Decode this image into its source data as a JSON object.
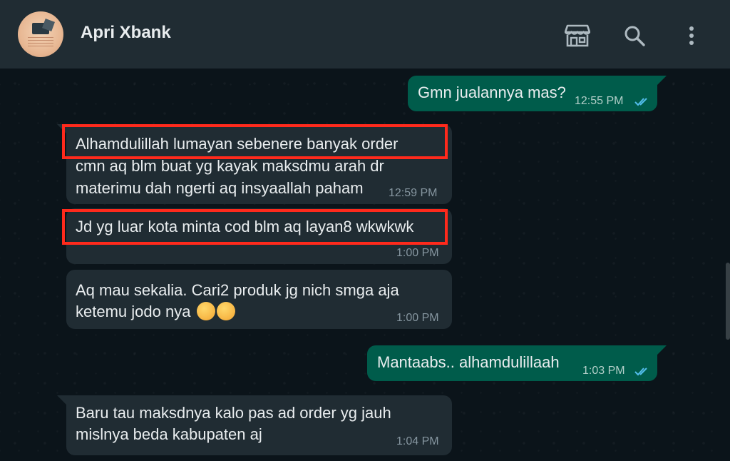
{
  "header": {
    "contact_name": "Apri Xbank",
    "icons": [
      "shop-icon",
      "search-icon",
      "more-vertical-icon"
    ]
  },
  "colors": {
    "header_bg": "#202c33",
    "chat_bg": "#0b141a",
    "incoming_bubble": "#202c33",
    "outgoing_bubble": "#005c4b",
    "highlight": "#ff2a1c",
    "read_ticks": "#53bdeb"
  },
  "messages": [
    {
      "direction": "out",
      "lines": [
        "Gmn jualannya mas?"
      ],
      "time": "12:55 PM",
      "status": "read"
    },
    {
      "direction": "in",
      "lines": [
        "Alhamdulillah lumayan sebenere banyak order",
        "cmn aq blm buat yg kayak maksdmu arah dr",
        "materimu dah ngerti aq insyaallah paham"
      ],
      "time": "12:59 PM",
      "highlight_first_line": true
    },
    {
      "direction": "in",
      "lines": [
        "Jd yg luar kota minta cod blm aq layan8 wkwkwk"
      ],
      "time": "1:00 PM",
      "highlight_first_line": true
    },
    {
      "direction": "in",
      "lines": [
        "Aq mau sekalia. Cari2 produk jg nich smga aja",
        "ketemu jodo nya"
      ],
      "time": "1:00 PM",
      "emoji": "face-with-hand-over-mouth x2"
    },
    {
      "direction": "out",
      "lines": [
        "Mantaabs.. alhamdulillaah"
      ],
      "time": "1:03 PM",
      "status": "read"
    },
    {
      "direction": "in",
      "lines": [
        "Baru tau maksdnya kalo pas ad order yg jauh",
        "mislnya beda kabupaten aj"
      ],
      "time": "1:04 PM"
    }
  ]
}
